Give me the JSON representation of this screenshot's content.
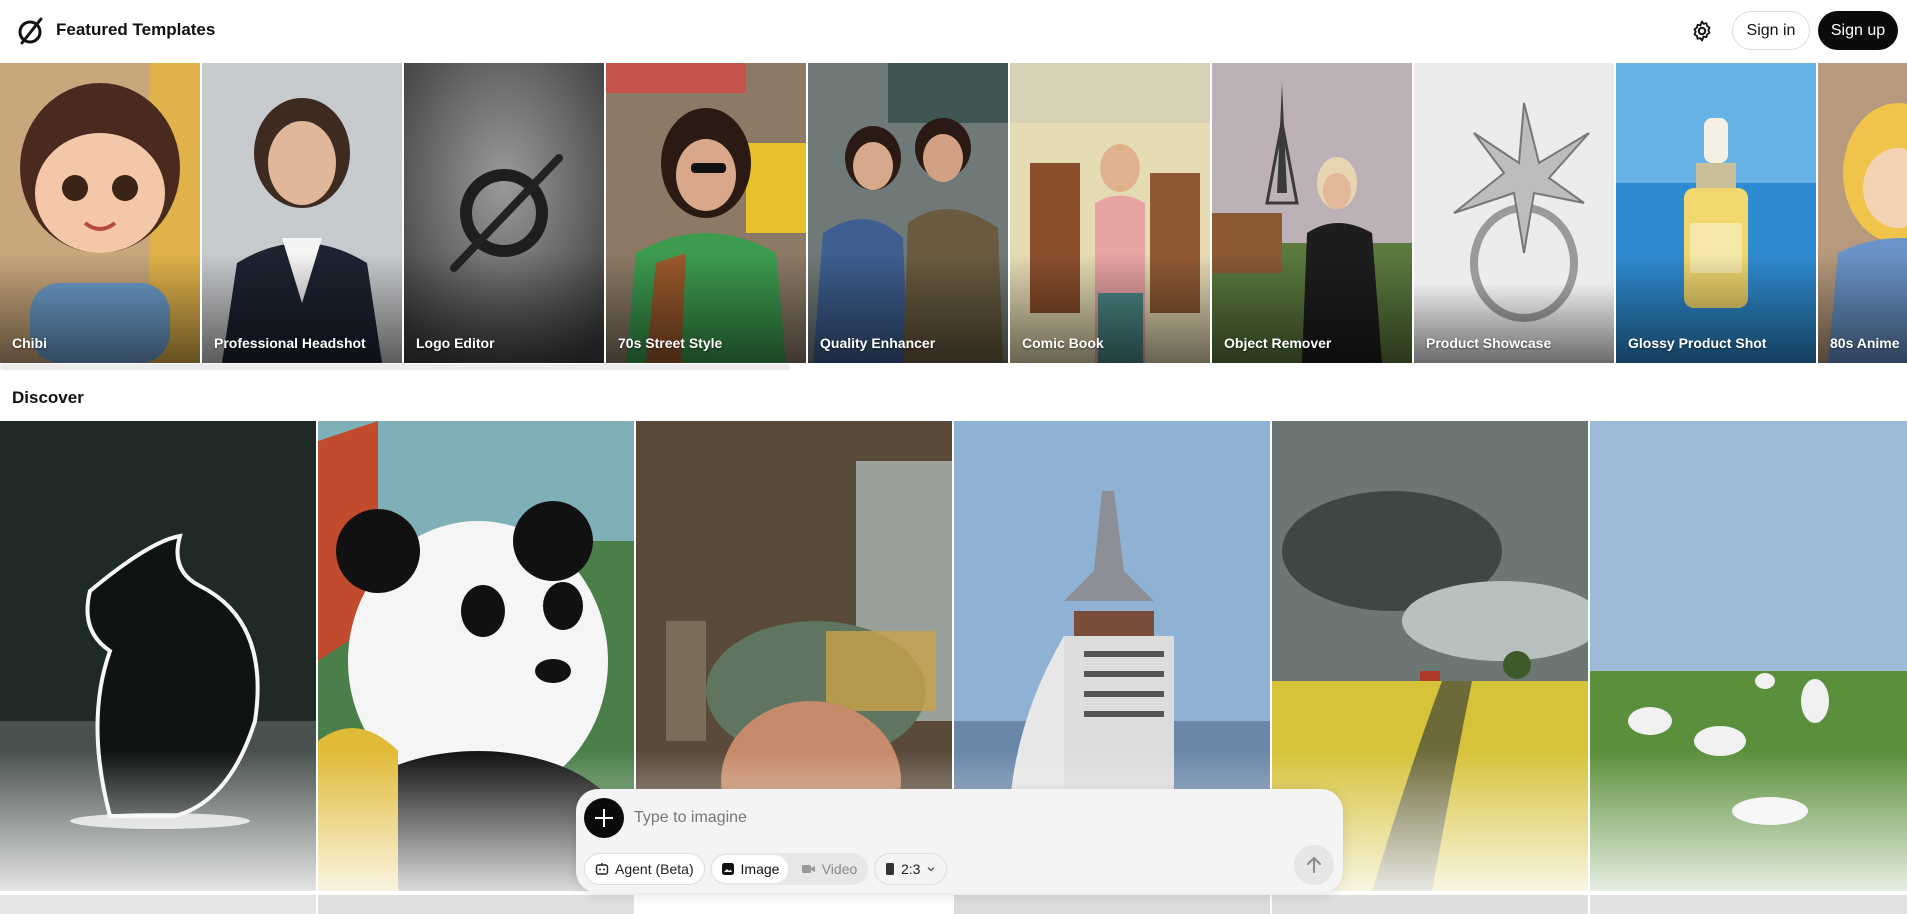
{
  "header": {
    "title": "Featured Templates",
    "signin_label": "Sign in",
    "signup_label": "Sign up",
    "settings_icon": "gear-icon",
    "logo_icon": "slashed-circle-logo"
  },
  "featured": [
    {
      "label": "Chibi"
    },
    {
      "label": "Professional Headshot"
    },
    {
      "label": "Logo Editor"
    },
    {
      "label": "70s Street Style"
    },
    {
      "label": "Quality Enhancer"
    },
    {
      "label": "Comic Book"
    },
    {
      "label": "Object Remover"
    },
    {
      "label": "Product Showcase"
    },
    {
      "label": "Glossy Product Shot"
    },
    {
      "label": "80s Anime"
    }
  ],
  "discover": {
    "title": "Discover"
  },
  "prompt": {
    "placeholder": "Type to imagine",
    "agent_label": "Agent (Beta)",
    "image_label": "Image",
    "video_label": "Video",
    "ratio_label": "2:3"
  },
  "colors": {
    "primary_button": "#0b0b0b",
    "prompt_bg": "#f4f4f4"
  }
}
